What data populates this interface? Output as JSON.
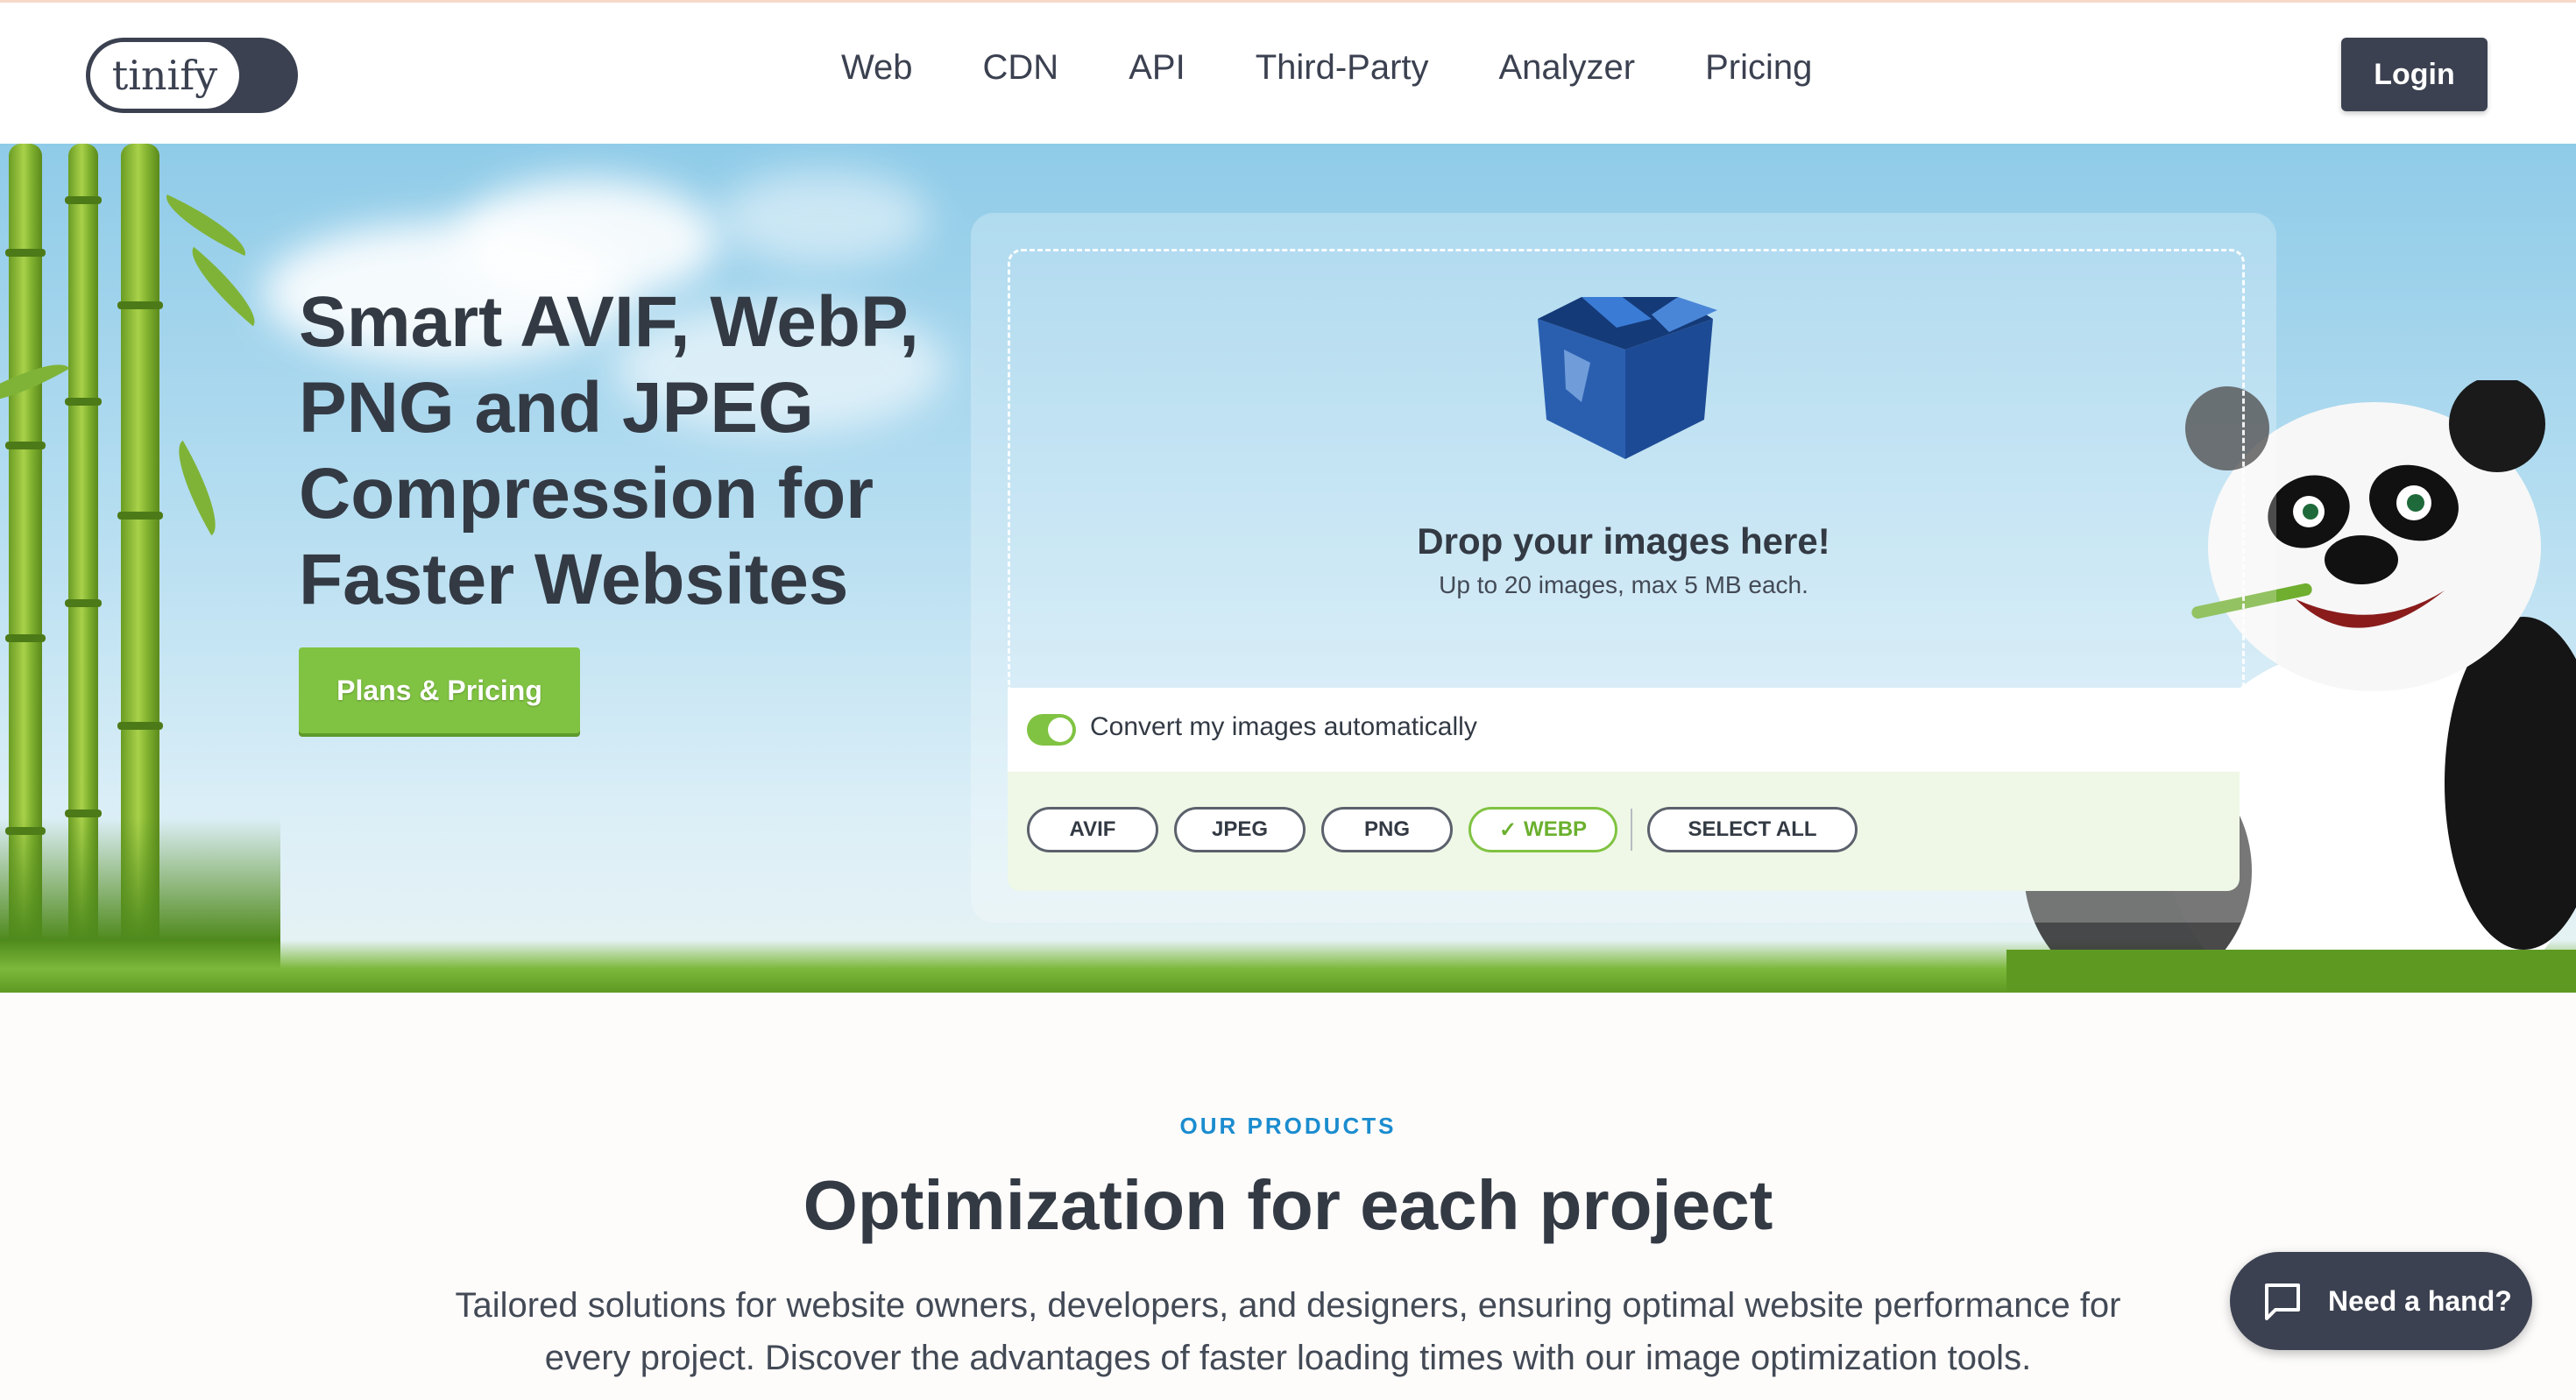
{
  "header": {
    "logo_text": "tinify",
    "nav": [
      "Web",
      "CDN",
      "API",
      "Third-Party",
      "Analyzer",
      "Pricing"
    ],
    "login_label": "Login"
  },
  "hero": {
    "title": "Smart AVIF, WebP, PNG and JPEG Compression for Faster Websites",
    "cta_label": "Plans & Pricing"
  },
  "dropzone": {
    "icon": "box-icon",
    "title": "Drop your images here!",
    "subtitle": "Up to 20 images, max 5 MB each.",
    "convert_label": "Convert my images automatically",
    "convert_enabled": true,
    "formats": [
      {
        "label": "AVIF",
        "selected": false
      },
      {
        "label": "JPEG",
        "selected": false
      },
      {
        "label": "PNG",
        "selected": false
      },
      {
        "label": "WEBP",
        "selected": true
      }
    ],
    "select_all_label": "SELECT ALL"
  },
  "products": {
    "eyebrow": "OUR PRODUCTS",
    "title": "Optimization for each project",
    "description": "Tailored solutions for website owners, developers, and designers, ensuring optimal website performance for every project. Discover the advantages of faster loading times with our image optimization tools."
  },
  "help_widget": {
    "label": "Need a hand?",
    "icon": "chat-icon"
  },
  "colors": {
    "brand_dark": "#3b4150",
    "accent_green": "#80c342",
    "accent_blue": "#1b8ccf"
  }
}
